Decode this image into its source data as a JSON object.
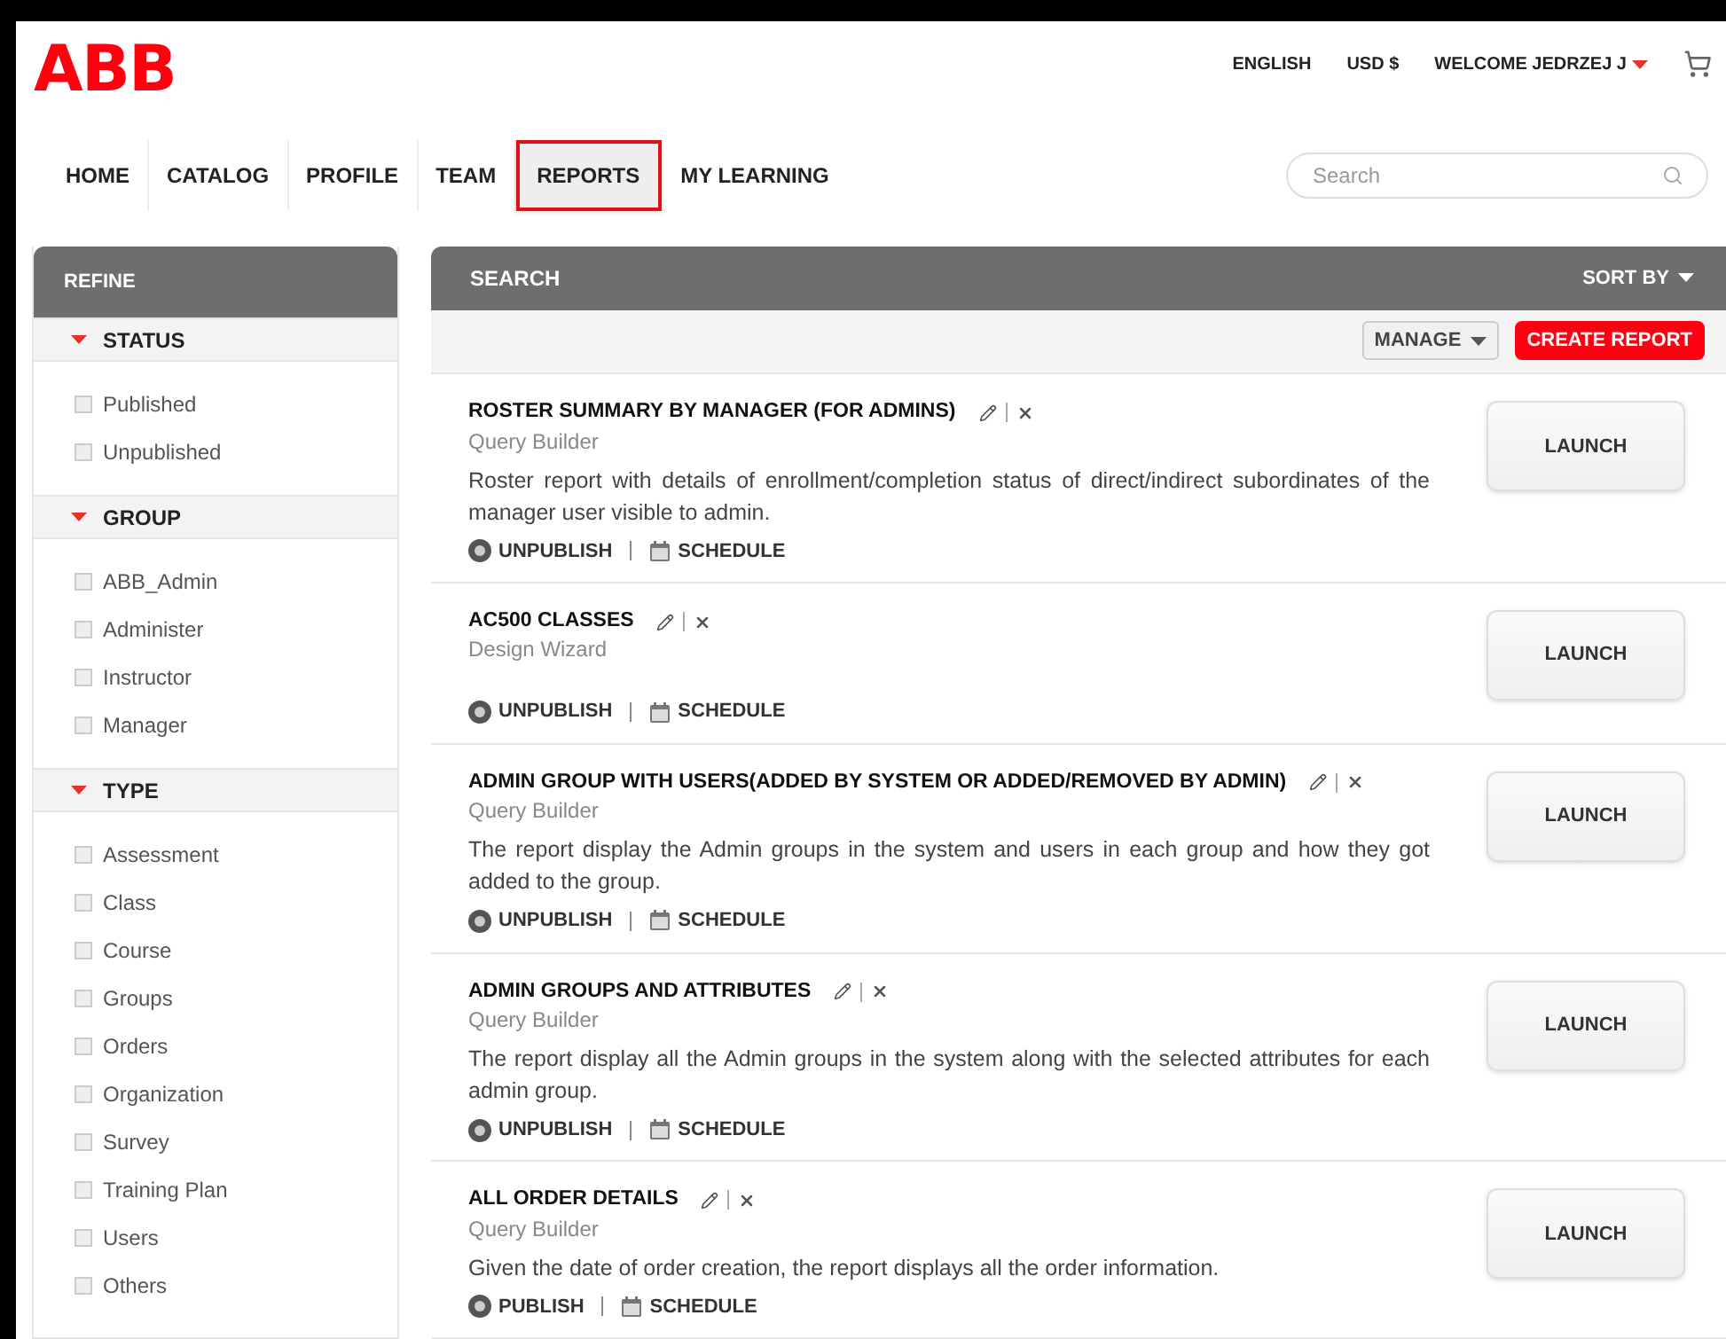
{
  "header": {
    "logo": "ABB",
    "links": [
      "ENGLISH",
      "USD $"
    ],
    "user": "WELCOME JEDRZEJ J"
  },
  "nav": [
    {
      "label": "HOME",
      "selected": false
    },
    {
      "label": "CATALOG",
      "selected": false
    },
    {
      "label": "PROFILE",
      "selected": false
    },
    {
      "label": "TEAM",
      "selected": false
    },
    {
      "label": "REPORTS",
      "selected": true
    },
    {
      "label": "MY LEARNING",
      "selected": false
    }
  ],
  "search": {
    "placeholder": "Search"
  },
  "refine": {
    "title": "REFINE",
    "sections": [
      {
        "title": "STATUS",
        "expanded": true,
        "items": [
          {
            "label": "Published",
            "checked": false
          },
          {
            "label": "Unpublished",
            "checked": false
          }
        ]
      },
      {
        "title": "GROUP",
        "expanded": true,
        "items": [
          {
            "label": "ABB_Admin",
            "checked": false
          },
          {
            "label": "Administer",
            "checked": false
          },
          {
            "label": "Instructor",
            "checked": false
          },
          {
            "label": "Manager",
            "checked": false
          }
        ]
      },
      {
        "title": "TYPE",
        "expanded": true,
        "items": [
          {
            "label": "Assessment",
            "checked": false
          },
          {
            "label": "Class",
            "checked": false
          },
          {
            "label": "Course",
            "checked": false
          },
          {
            "label": "Groups",
            "checked": false
          },
          {
            "label": "Orders",
            "checked": false
          },
          {
            "label": "Organization",
            "checked": false
          },
          {
            "label": "Survey",
            "checked": false
          },
          {
            "label": "Training Plan",
            "checked": false
          },
          {
            "label": "Users",
            "checked": false
          },
          {
            "label": "Others",
            "checked": false
          }
        ]
      }
    ]
  },
  "results": {
    "title": "SEARCH",
    "sort": "SORT BY",
    "manage": "MANAGE",
    "create": "CREATE REPORT",
    "reports": [
      {
        "title": "ROSTER SUMMARY BY MANAGER (FOR ADMINS)",
        "source": "Query Builder",
        "description": "Roster report with details of enrollment/completion status of direct/indirect subordinates of the manager user visible to admin.",
        "publish_action": "UNPUBLISH",
        "schedule": "SCHEDULE",
        "launch": "LAUNCH"
      },
      {
        "title": "AC500 CLASSES",
        "source": "Design Wizard",
        "publish_action": "UNPUBLISH",
        "schedule": "SCHEDULE",
        "launch": "LAUNCH"
      },
      {
        "title": "ADMIN GROUP WITH USERS(ADDED BY SYSTEM OR ADDED/REMOVED BY ADMIN)",
        "source": "Query Builder",
        "description": "The report display the Admin groups in the system and users in each group and how they got added to the group.",
        "publish_action": "UNPUBLISH",
        "schedule": "SCHEDULE",
        "launch": "LAUNCH"
      },
      {
        "title": "ADMIN GROUPS AND ATTRIBUTES",
        "source": "Query Builder",
        "description": "The report display all the Admin groups in the system along with the selected attributes for each admin group.",
        "publish_action": "UNPUBLISH",
        "schedule": "SCHEDULE",
        "launch": "LAUNCH"
      },
      {
        "title": "ALL ORDER DETAILS",
        "source": "Query Builder",
        "description": "Given the date of order creation, the report displays all the order information.",
        "publish_action": "PUBLISH",
        "schedule": "SCHEDULE",
        "launch": "LAUNCH"
      }
    ]
  }
}
